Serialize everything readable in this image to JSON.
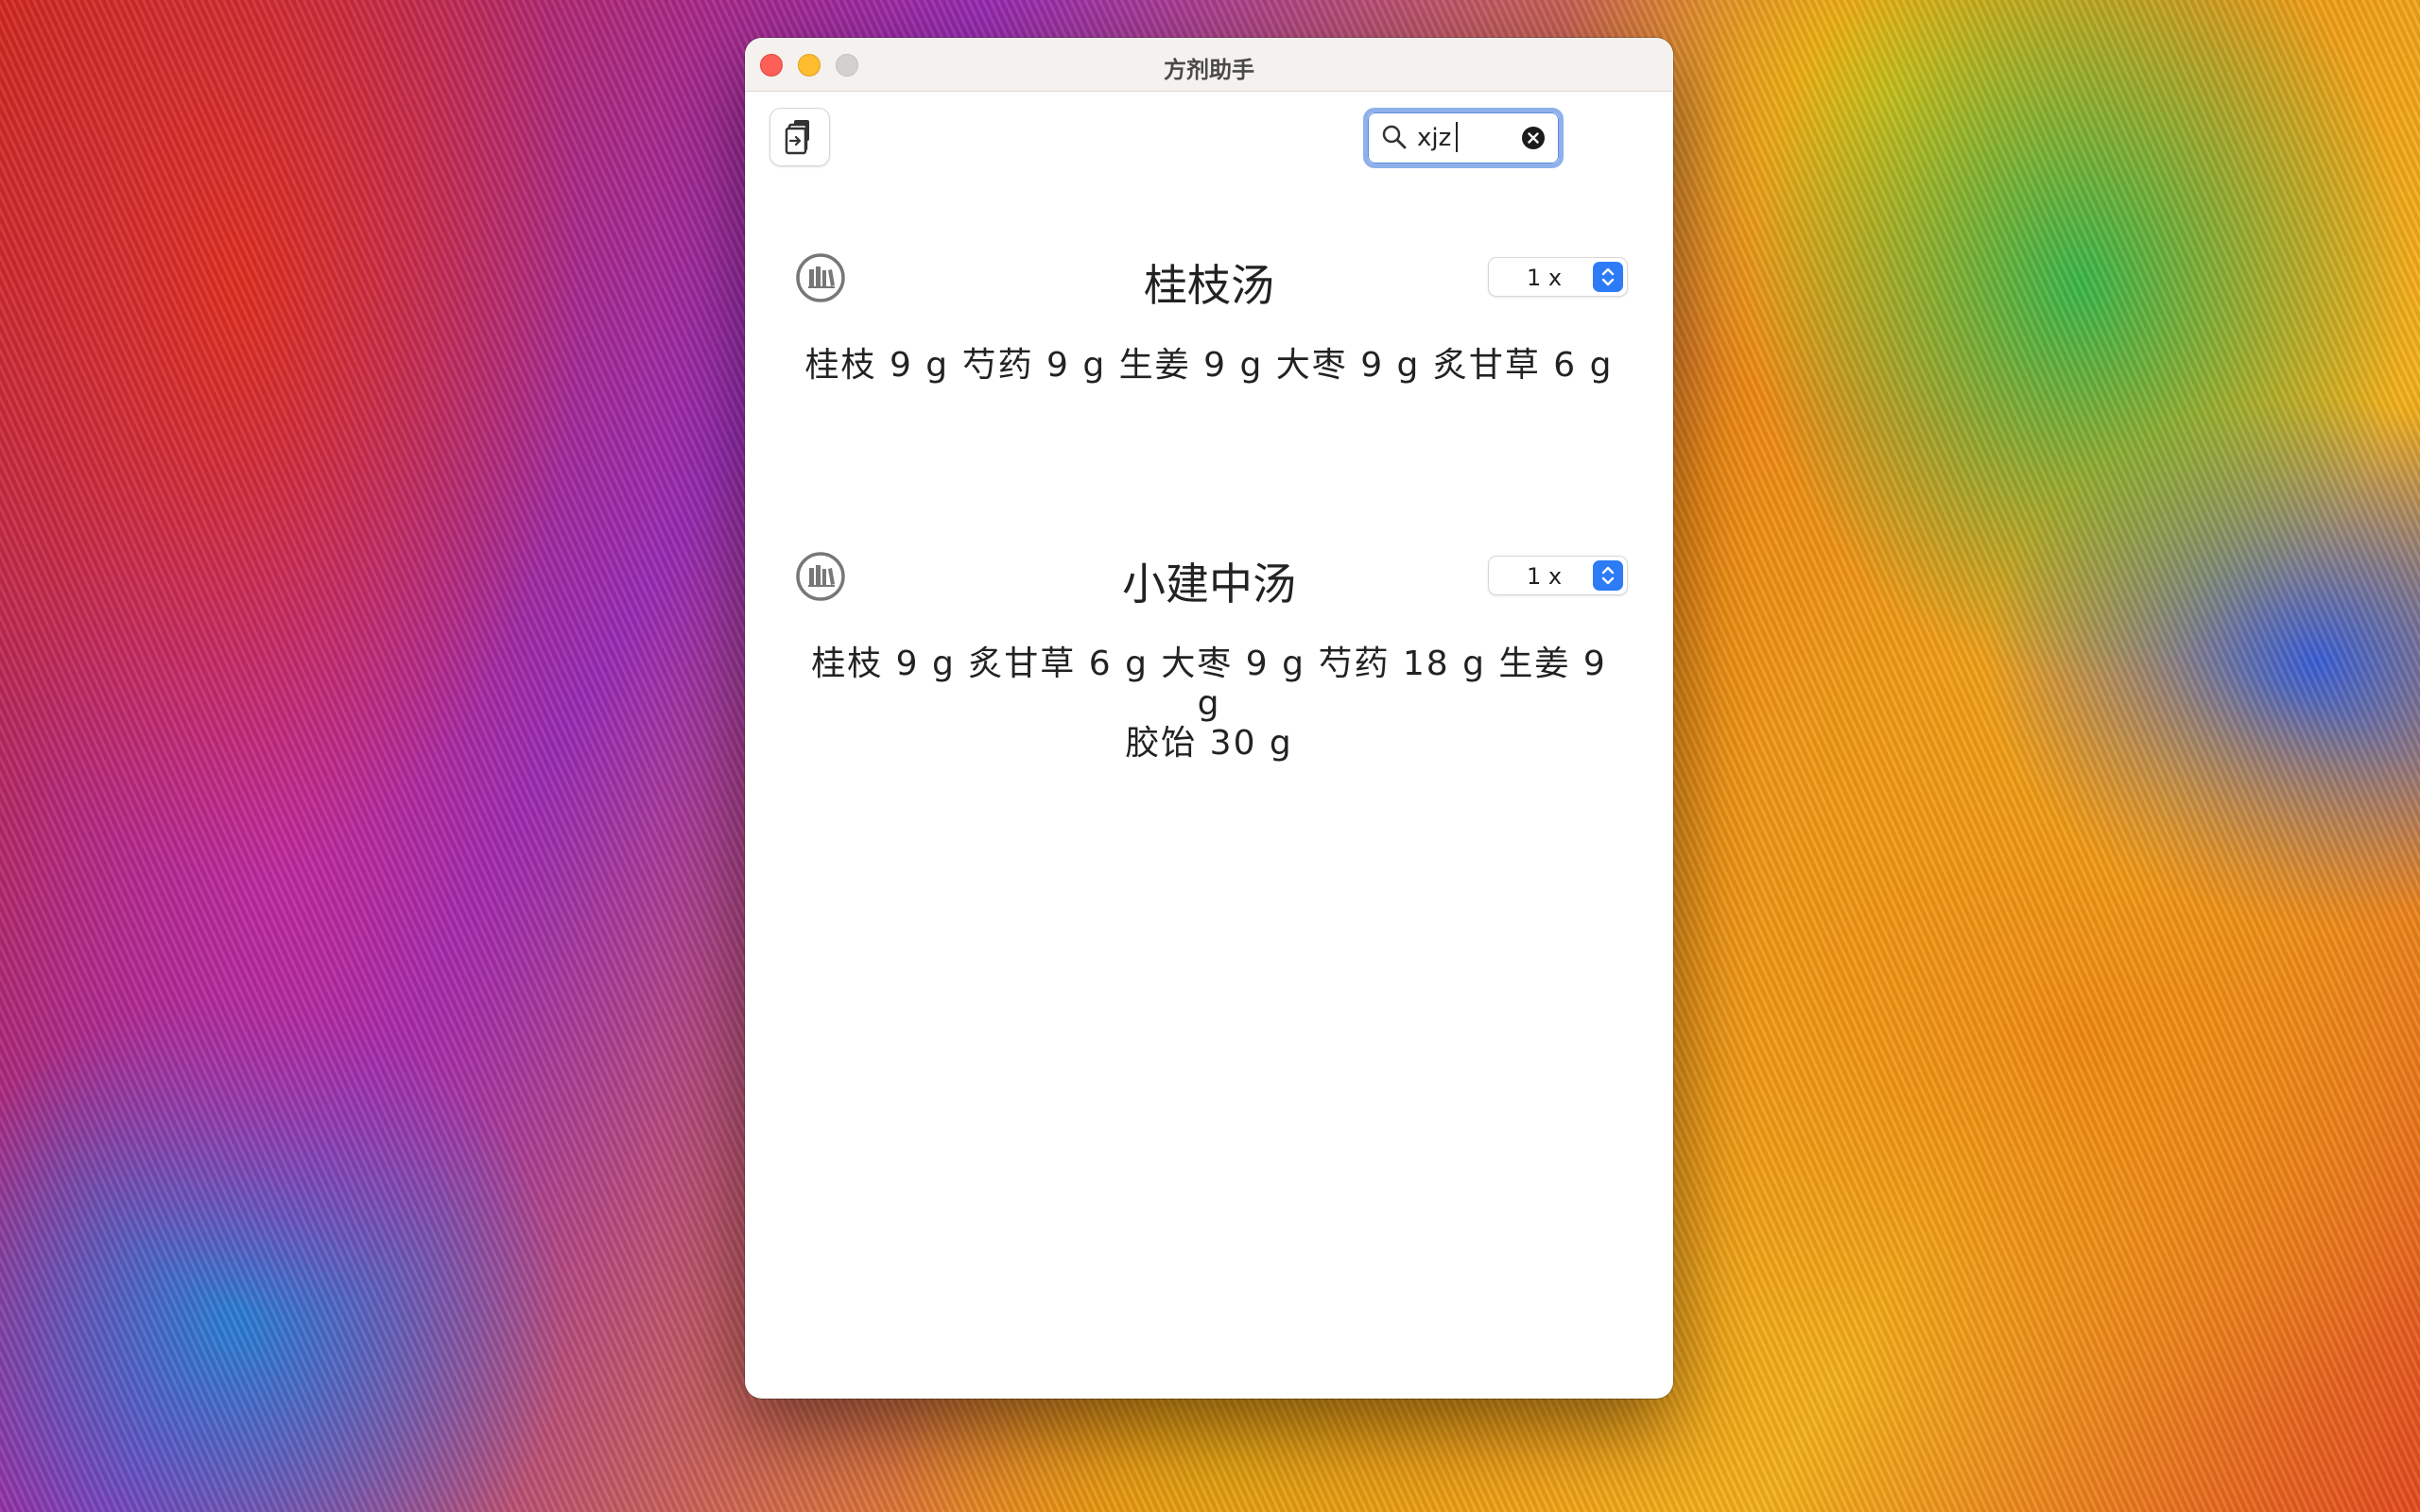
{
  "window": {
    "title": "方剂助手"
  },
  "toolbar": {
    "export_button_icon": "export-document-icon"
  },
  "search": {
    "value": "xjz",
    "icon": "search-icon",
    "clear_icon": "clear-circle-icon"
  },
  "formulas": [
    {
      "name": "桂枝汤",
      "multiplier": "1 x",
      "ingredients": "桂枝 9 g 芍药 9 g 生姜 9 g 大枣 9 g 炙甘草 6 g",
      "icon": "book-library-icon"
    },
    {
      "name": "小建中汤",
      "multiplier": "1 x",
      "ingredients_line1": "桂枝 9 g 炙甘草 6 g 大枣 9 g 芍药 18 g 生姜 9 g",
      "ingredients_line2": "胶饴 30 g",
      "icon": "book-library-icon"
    }
  ],
  "colors": {
    "accent": "#2d7cf6",
    "search_focus_ring": "#8fb0ea",
    "close": "#fe5f57",
    "minimize": "#febc2e",
    "zoom_disabled": "#d3d1cf"
  }
}
